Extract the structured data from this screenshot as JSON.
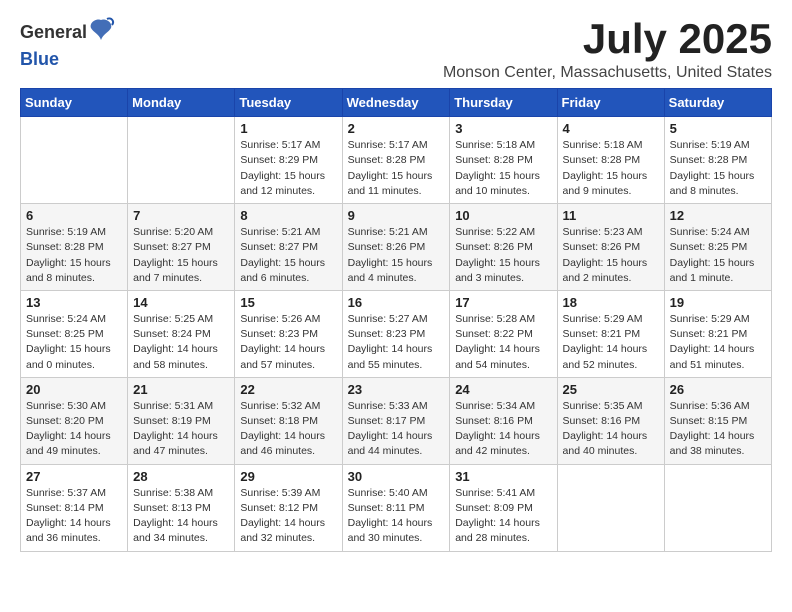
{
  "logo": {
    "general": "General",
    "blue": "Blue"
  },
  "title": {
    "month_year": "July 2025",
    "location": "Monson Center, Massachusetts, United States"
  },
  "days_of_week": [
    "Sunday",
    "Monday",
    "Tuesday",
    "Wednesday",
    "Thursday",
    "Friday",
    "Saturday"
  ],
  "weeks": [
    [
      {
        "day": "",
        "info": ""
      },
      {
        "day": "",
        "info": ""
      },
      {
        "day": "1",
        "info": "Sunrise: 5:17 AM\nSunset: 8:29 PM\nDaylight: 15 hours and 12 minutes."
      },
      {
        "day": "2",
        "info": "Sunrise: 5:17 AM\nSunset: 8:28 PM\nDaylight: 15 hours and 11 minutes."
      },
      {
        "day": "3",
        "info": "Sunrise: 5:18 AM\nSunset: 8:28 PM\nDaylight: 15 hours and 10 minutes."
      },
      {
        "day": "4",
        "info": "Sunrise: 5:18 AM\nSunset: 8:28 PM\nDaylight: 15 hours and 9 minutes."
      },
      {
        "day": "5",
        "info": "Sunrise: 5:19 AM\nSunset: 8:28 PM\nDaylight: 15 hours and 8 minutes."
      }
    ],
    [
      {
        "day": "6",
        "info": "Sunrise: 5:19 AM\nSunset: 8:28 PM\nDaylight: 15 hours and 8 minutes."
      },
      {
        "day": "7",
        "info": "Sunrise: 5:20 AM\nSunset: 8:27 PM\nDaylight: 15 hours and 7 minutes."
      },
      {
        "day": "8",
        "info": "Sunrise: 5:21 AM\nSunset: 8:27 PM\nDaylight: 15 hours and 6 minutes."
      },
      {
        "day": "9",
        "info": "Sunrise: 5:21 AM\nSunset: 8:26 PM\nDaylight: 15 hours and 4 minutes."
      },
      {
        "day": "10",
        "info": "Sunrise: 5:22 AM\nSunset: 8:26 PM\nDaylight: 15 hours and 3 minutes."
      },
      {
        "day": "11",
        "info": "Sunrise: 5:23 AM\nSunset: 8:26 PM\nDaylight: 15 hours and 2 minutes."
      },
      {
        "day": "12",
        "info": "Sunrise: 5:24 AM\nSunset: 8:25 PM\nDaylight: 15 hours and 1 minute."
      }
    ],
    [
      {
        "day": "13",
        "info": "Sunrise: 5:24 AM\nSunset: 8:25 PM\nDaylight: 15 hours and 0 minutes."
      },
      {
        "day": "14",
        "info": "Sunrise: 5:25 AM\nSunset: 8:24 PM\nDaylight: 14 hours and 58 minutes."
      },
      {
        "day": "15",
        "info": "Sunrise: 5:26 AM\nSunset: 8:23 PM\nDaylight: 14 hours and 57 minutes."
      },
      {
        "day": "16",
        "info": "Sunrise: 5:27 AM\nSunset: 8:23 PM\nDaylight: 14 hours and 55 minutes."
      },
      {
        "day": "17",
        "info": "Sunrise: 5:28 AM\nSunset: 8:22 PM\nDaylight: 14 hours and 54 minutes."
      },
      {
        "day": "18",
        "info": "Sunrise: 5:29 AM\nSunset: 8:21 PM\nDaylight: 14 hours and 52 minutes."
      },
      {
        "day": "19",
        "info": "Sunrise: 5:29 AM\nSunset: 8:21 PM\nDaylight: 14 hours and 51 minutes."
      }
    ],
    [
      {
        "day": "20",
        "info": "Sunrise: 5:30 AM\nSunset: 8:20 PM\nDaylight: 14 hours and 49 minutes."
      },
      {
        "day": "21",
        "info": "Sunrise: 5:31 AM\nSunset: 8:19 PM\nDaylight: 14 hours and 47 minutes."
      },
      {
        "day": "22",
        "info": "Sunrise: 5:32 AM\nSunset: 8:18 PM\nDaylight: 14 hours and 46 minutes."
      },
      {
        "day": "23",
        "info": "Sunrise: 5:33 AM\nSunset: 8:17 PM\nDaylight: 14 hours and 44 minutes."
      },
      {
        "day": "24",
        "info": "Sunrise: 5:34 AM\nSunset: 8:16 PM\nDaylight: 14 hours and 42 minutes."
      },
      {
        "day": "25",
        "info": "Sunrise: 5:35 AM\nSunset: 8:16 PM\nDaylight: 14 hours and 40 minutes."
      },
      {
        "day": "26",
        "info": "Sunrise: 5:36 AM\nSunset: 8:15 PM\nDaylight: 14 hours and 38 minutes."
      }
    ],
    [
      {
        "day": "27",
        "info": "Sunrise: 5:37 AM\nSunset: 8:14 PM\nDaylight: 14 hours and 36 minutes."
      },
      {
        "day": "28",
        "info": "Sunrise: 5:38 AM\nSunset: 8:13 PM\nDaylight: 14 hours and 34 minutes."
      },
      {
        "day": "29",
        "info": "Sunrise: 5:39 AM\nSunset: 8:12 PM\nDaylight: 14 hours and 32 minutes."
      },
      {
        "day": "30",
        "info": "Sunrise: 5:40 AM\nSunset: 8:11 PM\nDaylight: 14 hours and 30 minutes."
      },
      {
        "day": "31",
        "info": "Sunrise: 5:41 AM\nSunset: 8:09 PM\nDaylight: 14 hours and 28 minutes."
      },
      {
        "day": "",
        "info": ""
      },
      {
        "day": "",
        "info": ""
      }
    ]
  ]
}
